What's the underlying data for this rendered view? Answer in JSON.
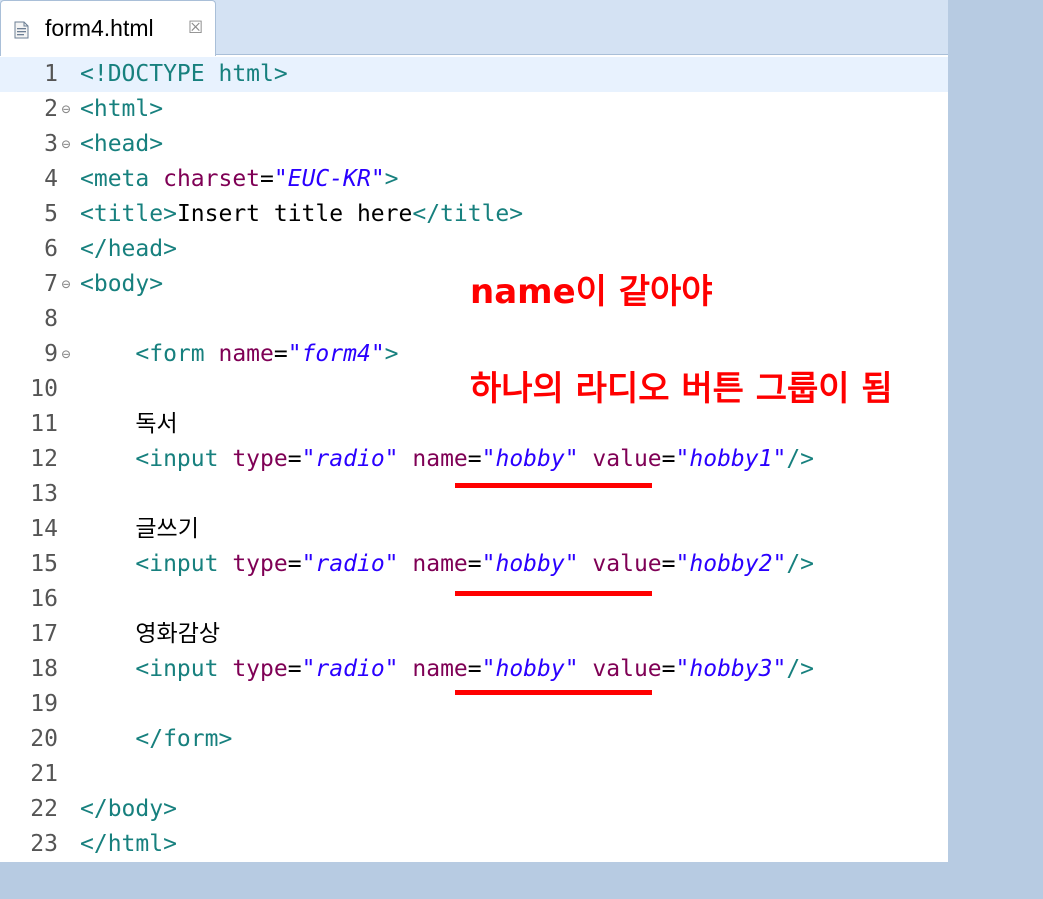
{
  "tab": {
    "file_name": "form4.html",
    "close_glyph": "☒"
  },
  "annotations": {
    "line1": "name이 같아야",
    "line2": "하나의 라디오 버튼 그룹이 됨"
  },
  "code_lines": [
    {
      "n": "1",
      "fold": false,
      "current": true,
      "tokens": [
        [
          "tag",
          "<!DOCTYPE html>"
        ]
      ]
    },
    {
      "n": "2",
      "fold": true,
      "tokens": [
        [
          "tag",
          "<html>"
        ]
      ]
    },
    {
      "n": "3",
      "fold": true,
      "tokens": [
        [
          "tag",
          "<head>"
        ]
      ]
    },
    {
      "n": "4",
      "fold": false,
      "tokens": [
        [
          "tag",
          "<meta "
        ],
        [
          "attr",
          "charset"
        ],
        [
          "plain",
          "="
        ],
        [
          "val",
          "\"EUC-KR\""
        ],
        [
          "tag",
          ">"
        ]
      ]
    },
    {
      "n": "5",
      "fold": false,
      "tokens": [
        [
          "tag",
          "<title>"
        ],
        [
          "plain",
          "Insert title here"
        ],
        [
          "tag",
          "</title>"
        ]
      ]
    },
    {
      "n": "6",
      "fold": false,
      "tokens": [
        [
          "tag",
          "</head>"
        ]
      ]
    },
    {
      "n": "7",
      "fold": true,
      "tokens": [
        [
          "tag",
          "<body>"
        ]
      ]
    },
    {
      "n": "8",
      "fold": false,
      "tokens": []
    },
    {
      "n": "9",
      "fold": true,
      "tokens": [
        [
          "plain",
          "    "
        ],
        [
          "tag",
          "<form "
        ],
        [
          "attr",
          "name"
        ],
        [
          "plain",
          "="
        ],
        [
          "val",
          "\"form4\""
        ],
        [
          "tag",
          ">"
        ]
      ]
    },
    {
      "n": "10",
      "fold": false,
      "tokens": []
    },
    {
      "n": "11",
      "fold": false,
      "tokens": [
        [
          "plain",
          "    독서"
        ]
      ]
    },
    {
      "n": "12",
      "fold": false,
      "tokens": [
        [
          "plain",
          "    "
        ],
        [
          "tag",
          "<input "
        ],
        [
          "attr",
          "type"
        ],
        [
          "plain",
          "="
        ],
        [
          "val",
          "\"radio\""
        ],
        [
          "plain",
          " "
        ],
        [
          "attr",
          "name"
        ],
        [
          "plain",
          "="
        ],
        [
          "val",
          "\"hobby\""
        ],
        [
          "plain",
          " "
        ],
        [
          "attr",
          "value"
        ],
        [
          "plain",
          "="
        ],
        [
          "val",
          "\"hobby1\""
        ],
        [
          "tag",
          "/>"
        ]
      ]
    },
    {
      "n": "13",
      "fold": false,
      "tokens": []
    },
    {
      "n": "14",
      "fold": false,
      "tokens": [
        [
          "plain",
          "    글쓰기"
        ]
      ]
    },
    {
      "n": "15",
      "fold": false,
      "tokens": [
        [
          "plain",
          "    "
        ],
        [
          "tag",
          "<input "
        ],
        [
          "attr",
          "type"
        ],
        [
          "plain",
          "="
        ],
        [
          "val",
          "\"radio\""
        ],
        [
          "plain",
          " "
        ],
        [
          "attr",
          "name"
        ],
        [
          "plain",
          "="
        ],
        [
          "val",
          "\"hobby\""
        ],
        [
          "plain",
          " "
        ],
        [
          "attr",
          "value"
        ],
        [
          "plain",
          "="
        ],
        [
          "val",
          "\"hobby2\""
        ],
        [
          "tag",
          "/>"
        ]
      ]
    },
    {
      "n": "16",
      "fold": false,
      "tokens": []
    },
    {
      "n": "17",
      "fold": false,
      "tokens": [
        [
          "plain",
          "    영화감상"
        ]
      ]
    },
    {
      "n": "18",
      "fold": false,
      "tokens": [
        [
          "plain",
          "    "
        ],
        [
          "tag",
          "<input "
        ],
        [
          "attr",
          "type"
        ],
        [
          "plain",
          "="
        ],
        [
          "val",
          "\"radio\""
        ],
        [
          "plain",
          " "
        ],
        [
          "attr",
          "name"
        ],
        [
          "plain",
          "="
        ],
        [
          "val",
          "\"hobby\""
        ],
        [
          "plain",
          " "
        ],
        [
          "attr",
          "value"
        ],
        [
          "plain",
          "="
        ],
        [
          "val",
          "\"hobby3\""
        ],
        [
          "tag",
          "/>"
        ]
      ]
    },
    {
      "n": "19",
      "fold": false,
      "tokens": []
    },
    {
      "n": "20",
      "fold": false,
      "tokens": [
        [
          "plain",
          "    "
        ],
        [
          "tag",
          "</form>"
        ]
      ]
    },
    {
      "n": "21",
      "fold": false,
      "tokens": []
    },
    {
      "n": "22",
      "fold": false,
      "tokens": [
        [
          "tag",
          "</body>"
        ]
      ]
    },
    {
      "n": "23",
      "fold": false,
      "tokens": [
        [
          "tag",
          "</html>"
        ]
      ]
    }
  ],
  "colors": {
    "tag": "#17807e",
    "attribute": "#7f0055",
    "string": "#2a00ff",
    "annotation": "#ff0000",
    "current_line": "#e8f2fe",
    "background": "#b7cbe2"
  },
  "icons": {
    "file_icon": "html-file-icon",
    "fold_icon": "fold-collapse-icon",
    "close_icon": "close-icon"
  }
}
